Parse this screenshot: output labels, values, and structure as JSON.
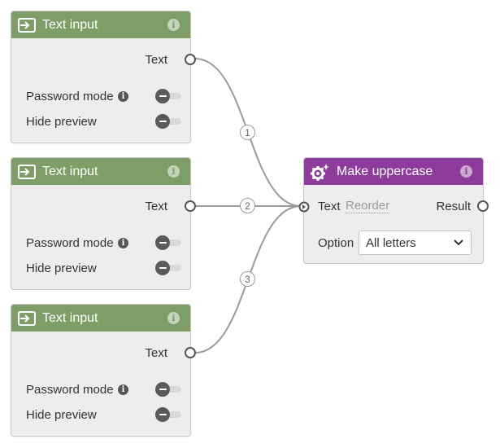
{
  "text_input_nodes": [
    {
      "title": "Text input",
      "output_label": "Text",
      "password_label": "Password mode",
      "password_info": "i",
      "hide_preview_label": "Hide preview",
      "info": "i"
    },
    {
      "title": "Text input",
      "output_label": "Text",
      "password_label": "Password mode",
      "password_info": "i",
      "hide_preview_label": "Hide preview",
      "info": "i"
    },
    {
      "title": "Text input",
      "output_label": "Text",
      "password_label": "Password mode",
      "password_info": "i",
      "hide_preview_label": "Hide preview",
      "info": "i"
    }
  ],
  "uppercase_node": {
    "title": "Make uppercase",
    "info": "i",
    "input_label": "Text",
    "reorder_label": "Reorder",
    "output_label": "Result",
    "option_label": "Option",
    "option_value": "All letters"
  },
  "connections": [
    {
      "order": "1"
    },
    {
      "order": "2"
    },
    {
      "order": "3"
    }
  ],
  "colors": {
    "text_input_header": "#7f9e67",
    "uppercase_header": "#8e3c9b",
    "wire": "#9a9a9a",
    "node_body": "#ededed"
  },
  "icons": {
    "text_input": "input-arrow-icon",
    "uppercase": "gear-sparkle-icon",
    "info": "info-icon",
    "toggle": "toggle-off-icon",
    "select": "chevron-down-icon"
  }
}
